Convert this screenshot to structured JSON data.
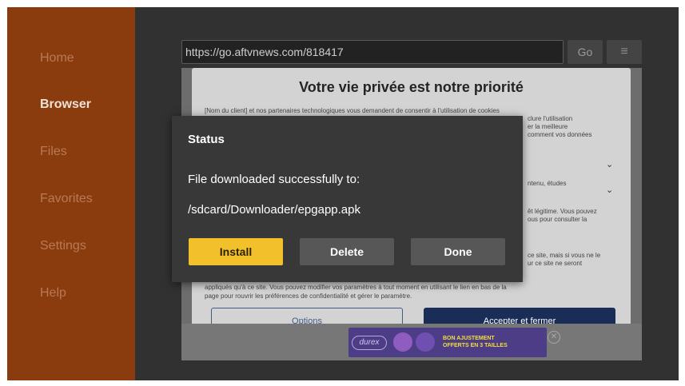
{
  "sidebar": {
    "items": [
      {
        "label": "Home"
      },
      {
        "label": "Browser"
      },
      {
        "label": "Files"
      },
      {
        "label": "Favorites"
      },
      {
        "label": "Settings"
      },
      {
        "label": "Help"
      }
    ]
  },
  "browser": {
    "url": "https://go.aftvnews.com/818417",
    "go_label": "Go",
    "menu_icon": "≡"
  },
  "privacy": {
    "title": "Votre vie privée est notre priorité",
    "line1": "[Nom du client] et nos partenaires technologiques vous demandent de consentir à l'utilisation de cookies",
    "frag1": "clure l'utilisation",
    "frag2": "er la meilleure",
    "frag3": "comment vos données",
    "frag4": "ntenu, études",
    "frag5": "êt légitime. Vous pouvez",
    "frag6": "ous pour consulter la",
    "frag7": "ce site, mais si vous ne le",
    "frag8": "ur ce site ne seront",
    "line_bottom1": "appliqués qu'à ce site. Vous pouvez modifier vos paramètres à tout moment en utilisant le lien en bas de la",
    "line_bottom2": "page pour rouvrir les préférences de confidentialité et gérer le paramètre.",
    "chevron": "⌄",
    "options_label": "Options",
    "accept_label": "Accepter et fermer"
  },
  "ad": {
    "brand": "durex",
    "text1": "BON AJUSTEMENT",
    "text2": "OFFERTS EN 3 TAILLES",
    "close": "✕"
  },
  "dialog": {
    "title": "Status",
    "message": "File downloaded successfully to:",
    "path": "/sdcard/Downloader/epgapp.apk",
    "install_label": "Install",
    "delete_label": "Delete",
    "done_label": "Done"
  },
  "colors": {
    "sidebar_bg": "#8a3c0e",
    "install_accent": "#f2c02a",
    "dialog_bg": "#383838"
  }
}
